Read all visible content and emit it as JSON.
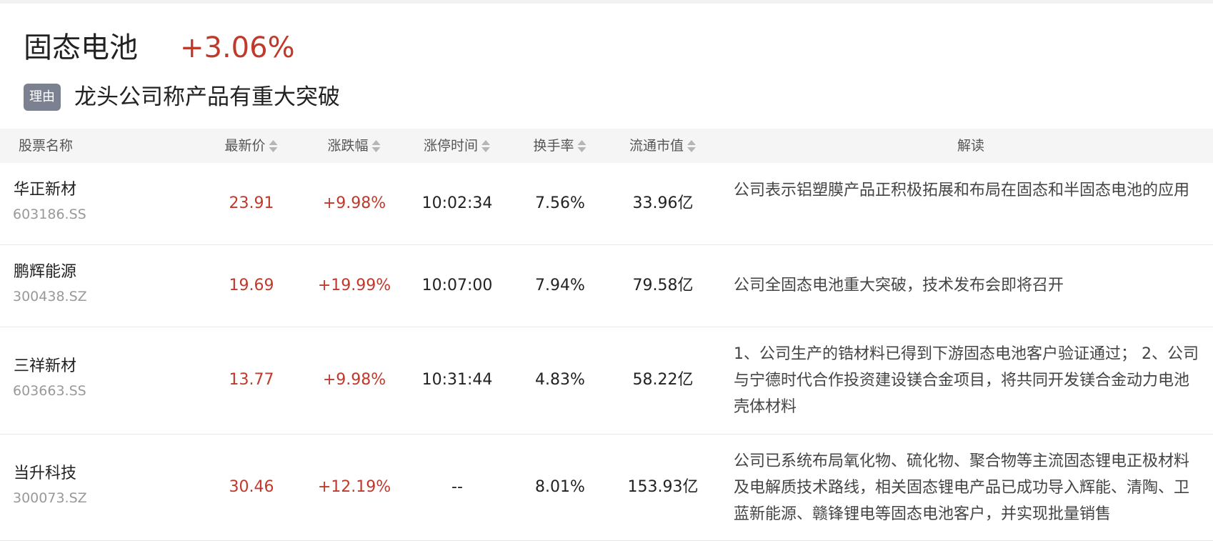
{
  "sector": {
    "title": "固态电池",
    "change": "+3.06%",
    "reason_tag": "理由",
    "reason_text": "龙头公司称产品有重大突破"
  },
  "table": {
    "columns": {
      "name": "股票名称",
      "price": "最新价",
      "change": "涨跌幅",
      "limit_time": "涨停时间",
      "turnover": "换手率",
      "market_cap": "流通市值",
      "interpretation": "解读"
    },
    "rows": [
      {
        "name": "华正新材",
        "code": "603186.SS",
        "price": "23.91",
        "change": "+9.98%",
        "limit_time": "10:02:34",
        "turnover": "7.56%",
        "market_cap": "33.96亿",
        "interpretation": "公司表示铝塑膜产品正积极拓展和布局在固态和半固态电池的应用"
      },
      {
        "name": "鹏辉能源",
        "code": "300438.SZ",
        "price": "19.69",
        "change": "+19.99%",
        "limit_time": "10:07:00",
        "turnover": "7.94%",
        "market_cap": "79.58亿",
        "interpretation": "公司全固态电池重大突破，技术发布会即将召开"
      },
      {
        "name": "三祥新材",
        "code": "603663.SS",
        "price": "13.77",
        "change": "+9.98%",
        "limit_time": "10:31:44",
        "turnover": "4.83%",
        "market_cap": "58.22亿",
        "interpretation": "1、公司生产的锆材料已得到下游固态电池客户验证通过； 2、公司与宁德时代合作投资建设镁合金项目，将共同开发镁合金动力电池壳体材料"
      },
      {
        "name": "当升科技",
        "code": "300073.SZ",
        "price": "30.46",
        "change": "+12.19%",
        "limit_time": "--",
        "turnover": "8.01%",
        "market_cap": "153.93亿",
        "interpretation": "公司已系统布局氧化物、硫化物、聚合物等主流固态锂电正极材料及电解质技术路线，相关固态锂电产品已成功导入辉能、清陶、卫蓝新能源、赣锋锂电等固态电池客户，并实现批量销售"
      }
    ]
  },
  "colors": {
    "up": "#c0392b",
    "tag_bg": "#7b8190",
    "header_bg": "#f5f5f5",
    "divider": "#e8e8e8"
  }
}
